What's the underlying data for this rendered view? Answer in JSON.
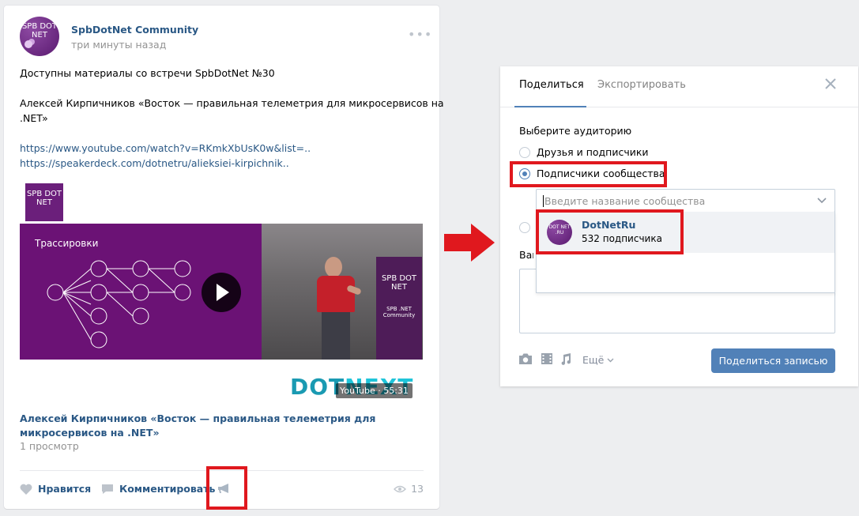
{
  "post": {
    "author": "SpbDotNet Community",
    "time": "три минуты назад",
    "avatar_text": "SPB DOT NET",
    "more_symbol": "•••",
    "lines": [
      "Доступны материалы со встречи SpbDotNet №30",
      "Алексей Кирпичников «Восток — правильная телеметрия для микросервисов на",
      ".NET»"
    ],
    "links": [
      "https://www.youtube.com/watch?v=RKmkXbUsK0w&list=..",
      "https://speakerdeck.com/dotnetru/alieksiei-kirpichnik.."
    ],
    "logo_text": "SPB DOT NET",
    "video": {
      "slide_title": "Трассировки",
      "banner_text": "SPB DOT NET",
      "banner_sub": "SPB .NET Community",
      "dotnext_a": "DOT",
      "dotnext_b": "NEXT",
      "badge": "YouTube · 55:31",
      "title": "Алексей Кирпичников «Восток — правильная телеметрия для микросервисов на .NET»",
      "views": "1 просмотр"
    },
    "actions": {
      "like": "Нравится",
      "comment": "Комментировать"
    },
    "view_count": "13"
  },
  "dialog": {
    "tabs": [
      "Поделиться",
      "Экспортировать"
    ],
    "audience_title": "Выберите аудиторию",
    "options": [
      "Друзья и подписчики",
      "Подписчики сообщества"
    ],
    "community_placeholder": "Введите название сообщества",
    "suggestion": {
      "name": "DotNetRu",
      "subscribers": "532 подписчика",
      "avatar_text": "DOT NET .RU"
    },
    "message_label": "Ваш",
    "more_label": "Ещё",
    "share_button": "Поделиться записью"
  },
  "colors": {
    "accent": "#5181b8",
    "link": "#2a5885",
    "highlight": "#e0181e",
    "background": "#edeef0"
  }
}
